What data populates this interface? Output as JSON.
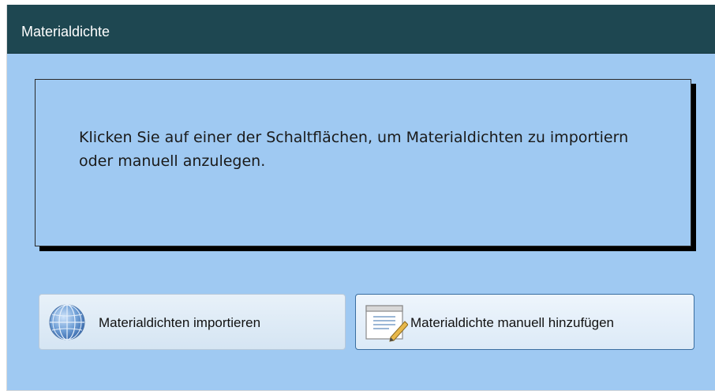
{
  "window": {
    "title": "Materialdichte"
  },
  "message": {
    "text": "Klicken Sie auf einer der Schaltflächen, um Materialdichten zu importiern oder manuell anzulegen."
  },
  "buttons": {
    "import": {
      "label": "Materialdichten importieren",
      "icon": "globe-icon"
    },
    "manual": {
      "label": "Materialdichte manuell hinzufügen",
      "icon": "edit-form-icon"
    }
  },
  "colors": {
    "titlebar": "#1e4751",
    "background": "#9fc9f2",
    "panel_shadow": "#000000"
  }
}
